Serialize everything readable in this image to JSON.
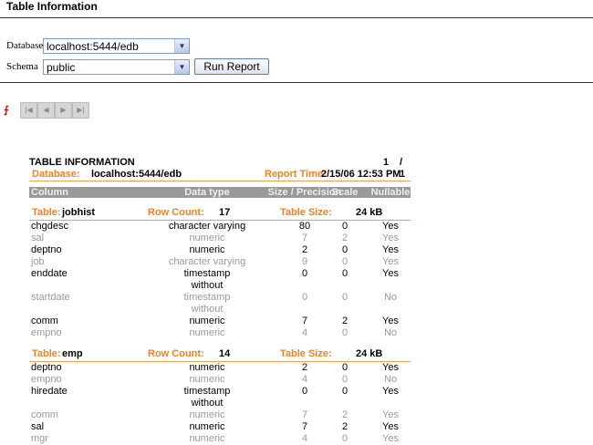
{
  "page_title": "Table Information",
  "form": {
    "database_label": "Database",
    "database_value": "localhost:5444/edb",
    "schema_label": "Schema",
    "schema_value": "public",
    "run_button": "Run Report"
  },
  "report": {
    "title": "TABLE INFORMATION",
    "page": "1",
    "page_total": "/ 1",
    "database_label": "Database:",
    "database_value": "localhost:5444/edb",
    "report_time_label": "Report Time:",
    "report_time_value": "2/15/06 12:53 PM",
    "headers": [
      "Column",
      "Data type",
      "Size / Precision",
      "Scale",
      "Nullable"
    ],
    "table_label": "Table:",
    "row_count_label": "Row Count:",
    "table_size_label": "Table Size:",
    "tables": [
      {
        "name": "jobhist",
        "row_count": "17",
        "size": "24 kB",
        "rows": [
          {
            "col": "chgdesc",
            "type": "character varying",
            "type2": "",
            "size": "80",
            "scale": "0",
            "nullable": "Yes"
          },
          {
            "col": "sal",
            "type": "numeric",
            "type2": "",
            "size": "7",
            "scale": "2",
            "nullable": "Yes"
          },
          {
            "col": "deptno",
            "type": "numeric",
            "type2": "",
            "size": "2",
            "scale": "0",
            "nullable": "Yes"
          },
          {
            "col": "job",
            "type": "character varying",
            "type2": "",
            "size": "9",
            "scale": "0",
            "nullable": "Yes"
          },
          {
            "col": "enddate",
            "type": "timestamp",
            "type2": "without",
            "size": "0",
            "scale": "0",
            "nullable": "Yes"
          },
          {
            "col": "startdate",
            "type": "timestamp",
            "type2": "without",
            "size": "0",
            "scale": "0",
            "nullable": "No"
          },
          {
            "col": "comm",
            "type": "numeric",
            "type2": "",
            "size": "7",
            "scale": "2",
            "nullable": "Yes"
          },
          {
            "col": "empno",
            "type": "numeric",
            "type2": "",
            "size": "4",
            "scale": "0",
            "nullable": "No"
          }
        ]
      },
      {
        "name": "emp",
        "row_count": "14",
        "size": "24 kB",
        "rows": [
          {
            "col": "deptno",
            "type": "numeric",
            "type2": "",
            "size": "2",
            "scale": "0",
            "nullable": "Yes"
          },
          {
            "col": "empno",
            "type": "numeric",
            "type2": "",
            "size": "4",
            "scale": "0",
            "nullable": "No"
          },
          {
            "col": "hiredate",
            "type": "timestamp",
            "type2": "without",
            "size": "0",
            "scale": "0",
            "nullable": "Yes"
          },
          {
            "col": "comm",
            "type": "numeric",
            "type2": "",
            "size": "7",
            "scale": "2",
            "nullable": "Yes"
          },
          {
            "col": "sal",
            "type": "numeric",
            "type2": "",
            "size": "7",
            "scale": "2",
            "nullable": "Yes"
          },
          {
            "col": "mgr",
            "type": "numeric",
            "type2": "",
            "size": "4",
            "scale": "0",
            "nullable": "Yes"
          }
        ]
      }
    ]
  }
}
